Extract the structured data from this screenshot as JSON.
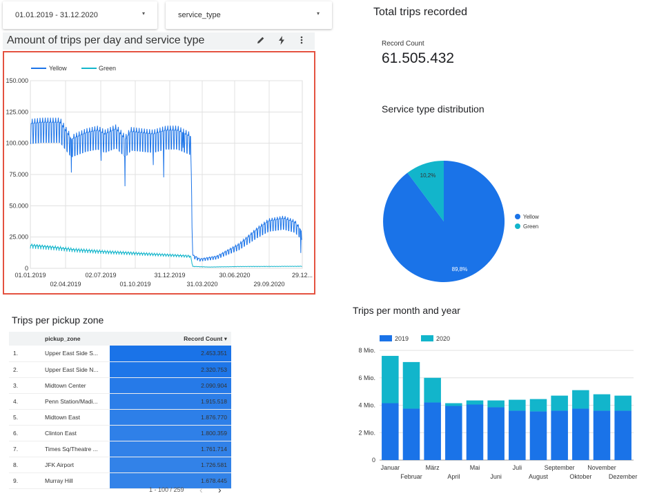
{
  "controls": {
    "date_range": "01.01.2019 - 31.12.2020",
    "dropdown": "service_type",
    "caret": "▾"
  },
  "line_chart": {
    "header_title": "Amount of trips per day and service type",
    "icons": [
      "pencil-icon",
      "lightning-icon",
      "more-vert-icon"
    ]
  },
  "scorecard": {
    "title": "Total trips recorded",
    "label": "Record Count",
    "value": "61.505.432"
  },
  "pie_title": "Service type distribution",
  "bar_title": "Trips per month and year",
  "table": {
    "title": "Trips per pickup zone",
    "col_zone": "pickup_zone",
    "col_count": "Record Count ▾",
    "rows": [
      {
        "rank": "1.",
        "zone": "Upper East Side S...",
        "count": "2.453.351"
      },
      {
        "rank": "2.",
        "zone": "Upper East Side N...",
        "count": "2.320.753"
      },
      {
        "rank": "3.",
        "zone": "Midtown Center",
        "count": "2.090.904"
      },
      {
        "rank": "4.",
        "zone": "Penn Station/Madi...",
        "count": "1.915.518"
      },
      {
        "rank": "5.",
        "zone": "Midtown East",
        "count": "1.876.770"
      },
      {
        "rank": "6.",
        "zone": "Clinton East",
        "count": "1.800.359"
      },
      {
        "rank": "7.",
        "zone": "Times Sq/Theatre ...",
        "count": "1.761.714"
      },
      {
        "rank": "8.",
        "zone": "JFK Airport",
        "count": "1.726.581"
      },
      {
        "rank": "9.",
        "zone": "Murray Hill",
        "count": "1.678.445"
      }
    ],
    "pagination": "1 - 100 / 259",
    "prev": "‹",
    "next": "›",
    "max_count": 2453351
  },
  "colors": {
    "yellow_series": "#1a73e8",
    "green_series": "#12b5cb",
    "bar_2019": "#1a73e8",
    "bar_2020": "#12b5cb",
    "pie_yellow": "#1a73e8",
    "pie_green": "#12b5cb",
    "highlight": "#e4513f"
  },
  "chart_data": [
    {
      "type": "line",
      "title": "Amount of trips per day and service type",
      "series": [
        {
          "name": "Yellow",
          "x": [
            "01.01.2019",
            "02.04.2019",
            "02.07.2019",
            "01.10.2019",
            "31.12.2019",
            "15.03.2020",
            "31.03.2020",
            "30.06.2020",
            "29.09.2020",
            "29.12.2020"
          ],
          "values": [
            115000,
            115000,
            110000,
            104000,
            110000,
            100000,
            8000,
            17000,
            38000,
            30000
          ]
        },
        {
          "name": "Green",
          "x": [
            "01.01.2019",
            "02.04.2019",
            "02.07.2019",
            "01.10.2019",
            "31.12.2019",
            "15.03.2020",
            "31.03.2020",
            "30.06.2020",
            "29.09.2020",
            "29.12.2020"
          ],
          "values": [
            18000,
            16000,
            14000,
            12500,
            12000,
            10000,
            1200,
            1200,
            1600,
            1600
          ]
        }
      ],
      "y_ticks": [
        "0",
        "25.000",
        "50.000",
        "75.000",
        "100.000",
        "125.000",
        "150.000"
      ],
      "x_ticks_top": [
        "01.01.2019",
        "02.07.2019",
        "31.12.2019",
        "30.06.2020",
        "29.12..."
      ],
      "x_ticks_bottom": [
        "02.04.2019",
        "01.10.2019",
        "31.03.2020",
        "29.09.2020"
      ],
      "ylim": [
        0,
        150000
      ],
      "legend": "top-left",
      "grid": true
    },
    {
      "type": "pie",
      "title": "Service type distribution",
      "labels": [
        "Yellow",
        "Green"
      ],
      "values": [
        89.8,
        10.2
      ],
      "value_labels": [
        "89,8%",
        "10,2%"
      ],
      "legend": "right"
    },
    {
      "type": "bar",
      "title": "Trips per month and year",
      "stacked": true,
      "categories": [
        "Januar",
        "Februar",
        "März",
        "April",
        "Mai",
        "Juni",
        "Juli",
        "August",
        "September",
        "Oktober",
        "November",
        "Dezember"
      ],
      "series": [
        {
          "name": "2019",
          "values": [
            4.15,
            3.75,
            4.2,
            3.95,
            4.05,
            3.85,
            3.6,
            3.55,
            3.6,
            3.75,
            3.6,
            3.6
          ]
        },
        {
          "name": "2020",
          "values": [
            3.45,
            3.4,
            1.8,
            0.2,
            0.3,
            0.5,
            0.8,
            0.9,
            1.1,
            1.35,
            1.2,
            1.1
          ]
        }
      ],
      "y_ticks": [
        "0",
        "2 Mio.",
        "4 Mio.",
        "6 Mio.",
        "8 Mio."
      ],
      "ylim": [
        0,
        8
      ],
      "legend": "top-left",
      "grid": true
    }
  ]
}
